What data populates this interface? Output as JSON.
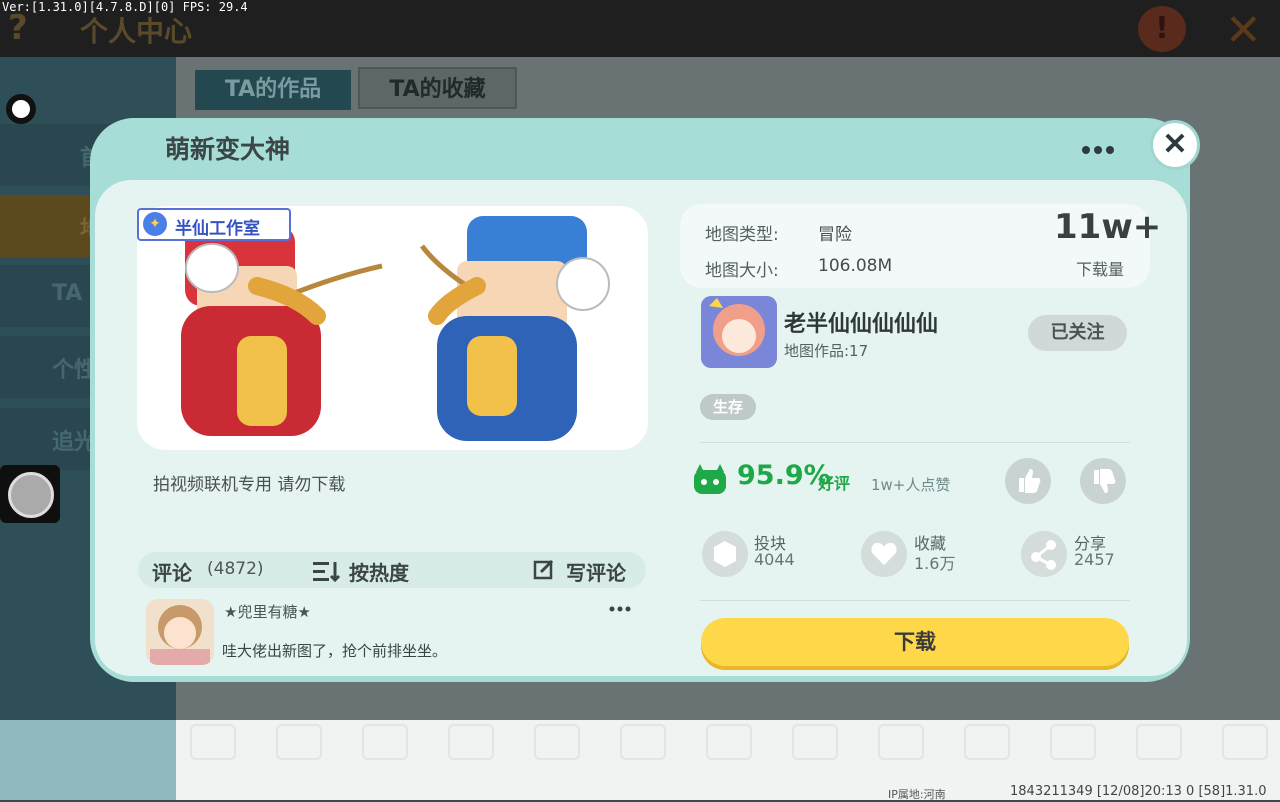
{
  "debug": "Ver:[1.31.0][4.7.8.D][0] FPS: 29.4",
  "background": {
    "title": "个人中心",
    "tabs": [
      "TA的作品",
      "TA的收藏"
    ],
    "sidebar_visible": [
      "首",
      "地",
      "TA",
      "个性",
      "追光"
    ],
    "footer_ip": "IP属地:河南",
    "footer_info": "1843211349   [12/08]20:13 0   [58]1.31.0"
  },
  "modal": {
    "title": "萌新变大神",
    "studio": "半仙工作室",
    "description": "拍视频联机专用 请勿下载",
    "map_type_label": "地图类型:",
    "map_type": "冒险",
    "map_size_label": "地图大小:",
    "map_size": "106.08M",
    "downloads": "11w+",
    "downloads_label": "下载量",
    "author": {
      "name": "老半仙仙仙仙仙",
      "works": "地图作品:17",
      "follow": "已关注"
    },
    "tag": "生存",
    "rating": {
      "percent": "95.9%",
      "text": "好评",
      "likes": "1w+人点赞"
    },
    "stats": [
      {
        "label": "投块",
        "value": "4044",
        "icon": "block-icon"
      },
      {
        "label": "收藏",
        "value": "1.6万",
        "icon": "heart-icon"
      },
      {
        "label": "分享",
        "value": "2457",
        "icon": "share-icon"
      }
    ],
    "download": "下载",
    "comments": {
      "label": "评论",
      "count": "(4872)",
      "sort": "按热度",
      "write": "写评论",
      "first": {
        "user": "★兜里有糖★",
        "text": "哇大佬出新图了，抢个前排坐坐。"
      }
    }
  },
  "colors": {
    "accent_green": "#1fa848",
    "download_yellow": "#ffd84a",
    "modal_bg": "#a6ddd6"
  }
}
